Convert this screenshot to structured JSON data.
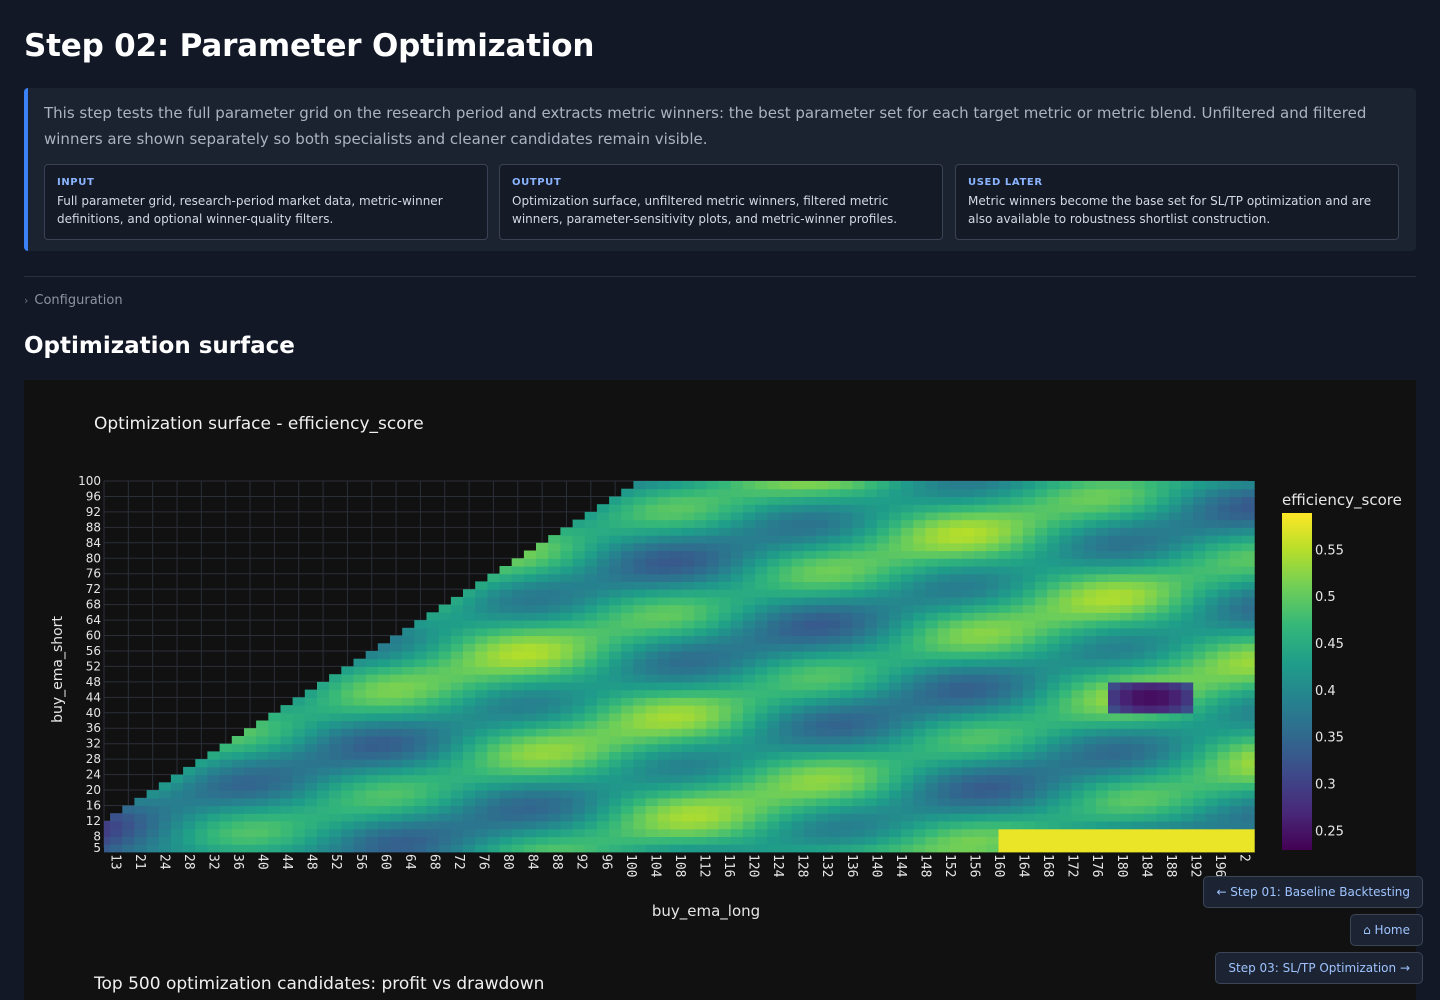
{
  "page": {
    "title": "Step 02: Parameter Optimization",
    "intro": "This step tests the full parameter grid on the research period and extracts metric winners: the best parameter set for each target metric or metric blend. Unfiltered and filtered winners are shown separately so both specialists and cleaner candidates remain visible."
  },
  "cards": [
    {
      "label": "INPUT",
      "text": "Full parameter grid, research-period market data, metric-winner definitions, and optional winner-quality filters."
    },
    {
      "label": "OUTPUT",
      "text": "Optimization surface, unfiltered metric winners, filtered metric winners, parameter-sensitivity plots, and metric-winner profiles."
    },
    {
      "label": "USED LATER",
      "text": "Metric winners become the base set for SL/TP optimization and are also available to robustness shortlist construction."
    }
  ],
  "config": {
    "chevron": "›",
    "label": "Configuration"
  },
  "section": {
    "title": "Optimization surface"
  },
  "chart_data": {
    "type": "heatmap",
    "title": "Optimization surface - efficiency_score",
    "xlabel": "buy_ema_long",
    "ylabel": "buy_ema_short",
    "x_tick_labels": [
      "13",
      "21",
      "24",
      "28",
      "32",
      "36",
      "40",
      "44",
      "48",
      "52",
      "56",
      "60",
      "64",
      "68",
      "72",
      "76",
      "80",
      "84",
      "88",
      "92",
      "96",
      "100",
      "104",
      "108",
      "112",
      "116",
      "120",
      "124",
      "128",
      "132",
      "136",
      "140",
      "144",
      "148",
      "152",
      "156",
      "160",
      "164",
      "168",
      "172",
      "176",
      "180",
      "184",
      "188",
      "192",
      "196",
      "2"
    ],
    "y_tick_labels": [
      "5",
      "8",
      "12",
      "16",
      "20",
      "24",
      "28",
      "32",
      "36",
      "40",
      "44",
      "48",
      "52",
      "56",
      "60",
      "64",
      "68",
      "72",
      "76",
      "80",
      "84",
      "88",
      "92",
      "96",
      "100"
    ],
    "x_range": [
      13,
      201
    ],
    "y_range": [
      5,
      100
    ],
    "colorbar_title": "efficiency_score",
    "colorbar_ticks": [
      "0.25",
      "0.3",
      "0.35",
      "0.4",
      "0.45",
      "0.5",
      "0.55"
    ],
    "z_range": [
      0.23,
      0.59
    ],
    "colorscale": "viridis",
    "colors": [
      "#440154",
      "#482878",
      "#3e4989",
      "#31688e",
      "#26828e",
      "#1f9e89",
      "#35b779",
      "#6ece58",
      "#b5de2b",
      "#fde725"
    ],
    "region": "cells exist only where buy_ema_short < buy_ema_long",
    "structure": {
      "base": 0.44,
      "diagonal_bands": 0.06,
      "low_region_buy_ema_long_13_52_short_5_24": 0.29,
      "low_region_buy_ema_long_180_190_short_40_48": 0.24,
      "high_band_buy_ema_long_160_200_short_8": 0.58
    },
    "grid": true
  },
  "next_chart": {
    "title": "Top 500 optimization candidates: profit vs drawdown"
  },
  "nav": {
    "prev": "← Step 01: Baseline Backtesting",
    "home": "⌂ Home",
    "next": "Step 03: SL/TP Optimization →"
  }
}
